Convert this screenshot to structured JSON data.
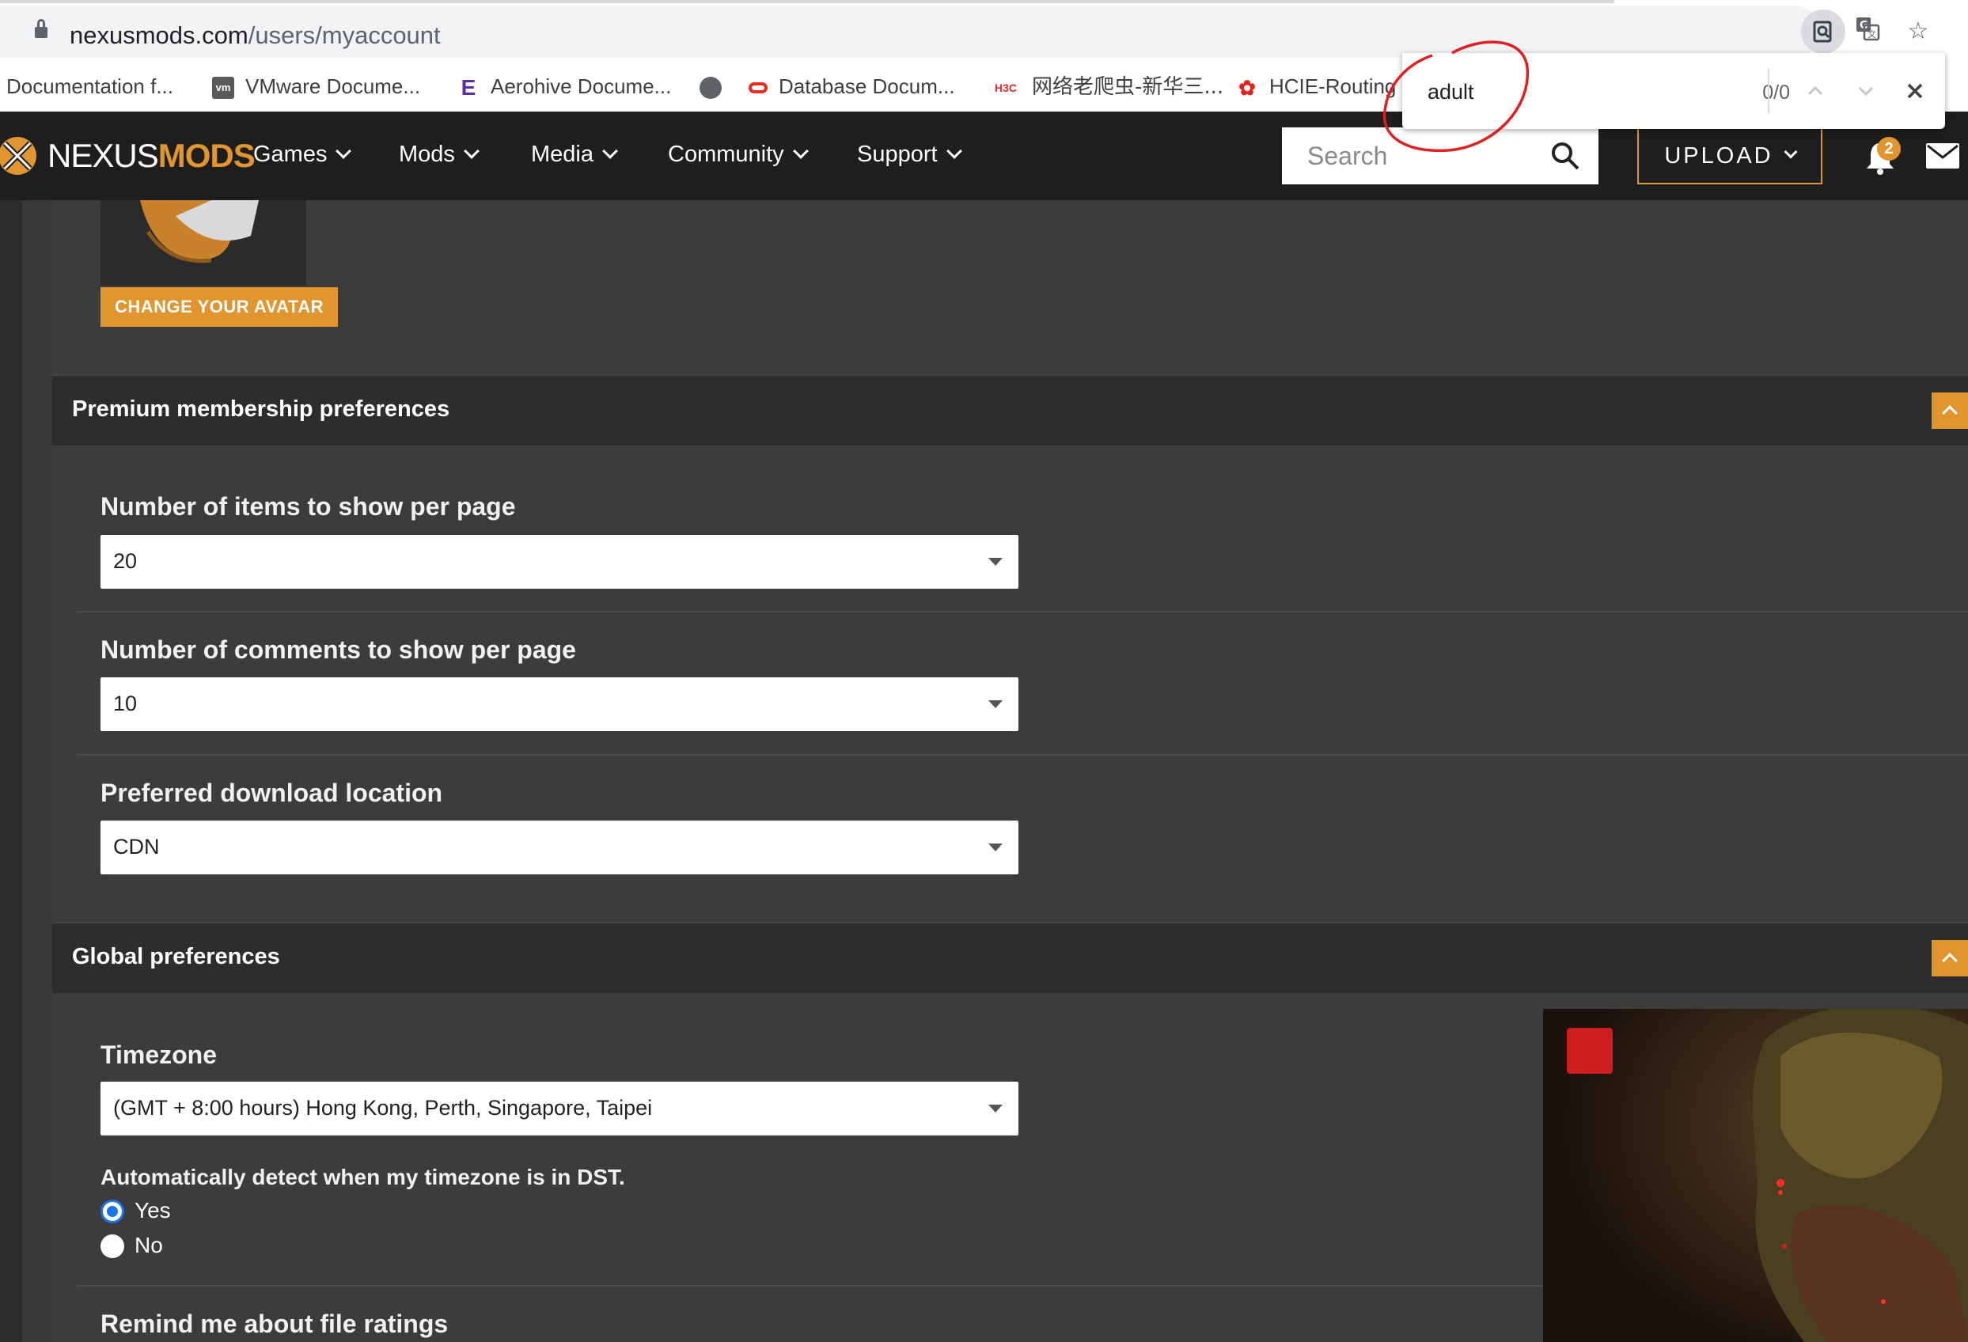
{
  "browser": {
    "url_domain": "nexusmods.com",
    "url_path": "/users/myaccount",
    "icons": [
      "lock-icon",
      "search-page-icon",
      "translate-icon",
      "bookmark-star-icon"
    ],
    "bookmarks": [
      {
        "label": "Documentation f...",
        "icon": "doc-icon"
      },
      {
        "label": "VMware Docume...",
        "icon_text": "vm"
      },
      {
        "label": "Aerohive Docume...",
        "icon_text": "E"
      },
      {
        "label": "",
        "icon": "globe-icon"
      },
      {
        "label": "Database Docum...",
        "icon": "oracle-icon"
      },
      {
        "label": "网络老爬虫-新华三...",
        "icon_text": "H3C"
      },
      {
        "label": "HCIE-Routing",
        "icon": "huawei-icon"
      }
    ]
  },
  "find_bar": {
    "query": "adult",
    "count": "0/0"
  },
  "site": {
    "logo_a": "NEXUS",
    "logo_b": "MODS",
    "nav": [
      "Games",
      "Mods",
      "Media",
      "Community",
      "Support"
    ],
    "search_placeholder": "Search",
    "upload_label": "UPLOAD",
    "notification_count": "2"
  },
  "avatar": {
    "change_label": "CHANGE YOUR AVATAR"
  },
  "premium": {
    "title": "Premium membership preferences",
    "items_label": "Number of items to show per page",
    "items_value": "20",
    "comments_label": "Number of comments to show per page",
    "comments_value": "10",
    "download_label": "Preferred download location",
    "download_value": "CDN"
  },
  "global": {
    "title": "Global preferences",
    "timezone_label": "Timezone",
    "timezone_value": "(GMT + 8:00 hours) Hong Kong, Perth, Singapore, Taipei",
    "dst_question": "Automatically detect when my timezone is in DST.",
    "dst_yes": "Yes",
    "dst_no": "No",
    "dst_selected": "Yes",
    "remind_label": "Remind me about file ratings"
  },
  "colors": {
    "accent": "#e0952e",
    "nav_bg": "#1e1e1e",
    "content_bg": "#3c3c3c",
    "radio_blue": "#1a73e8",
    "annotation_red": "#e02020"
  }
}
